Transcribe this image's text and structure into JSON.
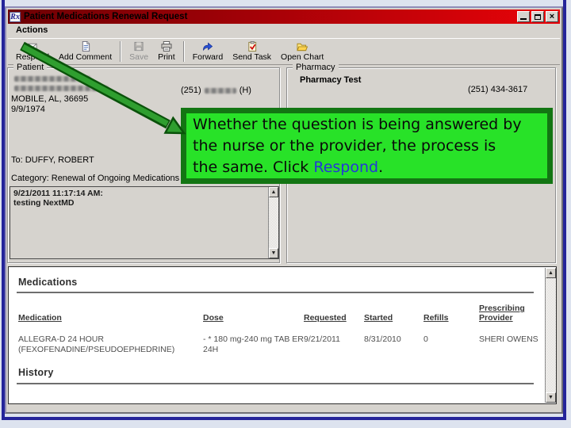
{
  "window": {
    "title": "Patient Medications Renewal Request",
    "rx_icon": "Rx"
  },
  "menubar": {
    "actions": "Actions"
  },
  "toolbar": {
    "respond": "Respond",
    "add_comment": "Add Comment",
    "save": "Save",
    "print": "Print",
    "forward": "Forward",
    "send_task": "Send Task",
    "open_chart": "Open Chart"
  },
  "patient": {
    "section_label": "Patient",
    "city_line": "MOBILE, AL, 36695",
    "dob": "9/9/1974",
    "phone_prefix": "(251)",
    "phone_suffix": "(H)",
    "to_line": "To: DUFFY, ROBERT",
    "category_line": "Category: Renewal of Ongoing Medications",
    "note_timestamp": "9/21/2011 11:17:14 AM:",
    "note_text": "testing NextMD"
  },
  "pharmacy": {
    "section_label": "Pharmacy",
    "name": "Pharmacy Test",
    "phone": "(251) 434-3617"
  },
  "callout": {
    "line1": "Whether the question is being answered by",
    "line2": "the nurse or the provider, the process is",
    "line3_prefix": "the same.  Click ",
    "line3_link": "Respond",
    "line3_suffix": ".",
    "bg_color": "#28e228",
    "border_color": "#137513",
    "link_color": "#2437d8"
  },
  "medications": {
    "section_title": "Medications",
    "history_title": "History",
    "headers": {
      "medication": "Medication",
      "dose": "Dose",
      "requested": "Requested",
      "started": "Started",
      "refills": "Refills",
      "provider": "Prescribing Provider"
    },
    "row": {
      "medication_line1": "ALLEGRA-D 24 HOUR",
      "medication_line2": "(FEXOFENADINE/PSEUDOEPHEDRINE)",
      "dose_line1": "- * 180 mg-240 mg TAB ER",
      "dose_line2": "24H",
      "requested": "9/21/2011",
      "started": "8/31/2010",
      "refills": "0",
      "provider": "SHERI OWENS"
    }
  },
  "colors": {
    "titlebar_gradient_left": "#6d0004",
    "titlebar_gradient_right": "#e90309",
    "dialog_bg": "#d6d3ce",
    "frame_border": "#24249a",
    "slide_bg": "#dde3ef"
  }
}
